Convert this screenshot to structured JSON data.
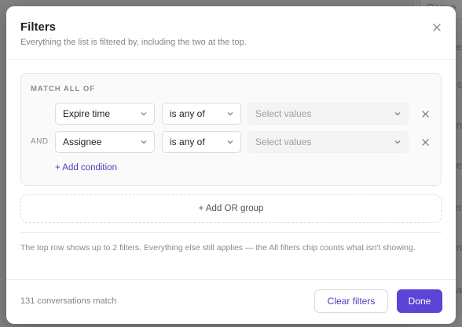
{
  "background": {
    "fragments": [
      "Conve",
      "e",
      "s",
      "n",
      "e",
      "r",
      "n",
      "a",
      "er"
    ]
  },
  "modal": {
    "title": "Filters",
    "subtitle": "Everything the list is filtered by, including the two at the top.",
    "close_icon": "close-icon"
  },
  "group": {
    "match_label": "MATCH ALL OF",
    "conditions": [
      {
        "conj": "",
        "field": "Expire time",
        "operator": "is any of",
        "values_placeholder": "Select values"
      },
      {
        "conj": "AND",
        "field": "Assignee",
        "operator": "is any of",
        "values_placeholder": "Select values"
      }
    ],
    "add_condition_label": "+ Add condition"
  },
  "add_or_group_label": "+ Add OR group",
  "hint": "The top row shows up to 2 filters. Everything else still applies — the All filters chip counts what isn't showing.",
  "footer": {
    "match_count": "131 conversations match",
    "clear_label": "Clear filters",
    "done_label": "Done"
  },
  "colors": {
    "accent": "#5b44d6",
    "link": "#4b3fbf"
  }
}
